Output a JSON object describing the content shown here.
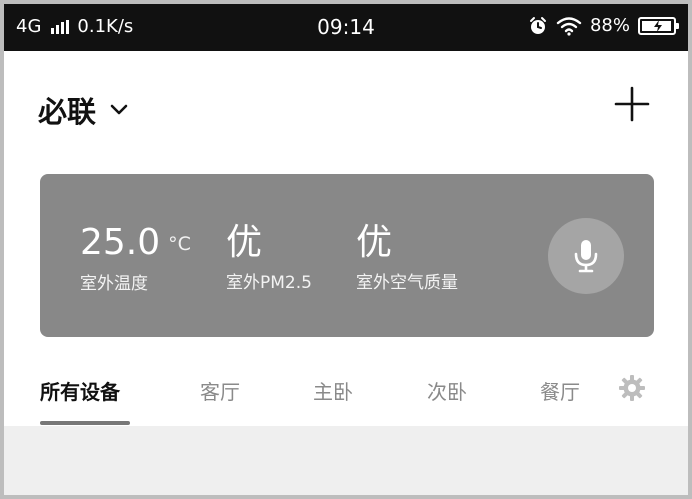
{
  "status_bar": {
    "network": "4G",
    "speed": "0.1K/s",
    "time": "09:14",
    "battery": "88%"
  },
  "header": {
    "title": "必联"
  },
  "weather": {
    "temperature": {
      "value": "25.0",
      "unit": "°C",
      "label": "室外温度"
    },
    "pm25": {
      "value": "优",
      "label": "室外PM2.5"
    },
    "air_quality": {
      "value": "优",
      "label": "室外空气质量"
    }
  },
  "tabs": [
    {
      "label": "所有设备",
      "active": true
    },
    {
      "label": "客厅",
      "active": false
    },
    {
      "label": "主卧",
      "active": false
    },
    {
      "label": "次卧",
      "active": false
    },
    {
      "label": "餐厅",
      "active": false
    }
  ],
  "colors": {
    "status_bar_bg": "#111111",
    "card_bg": "#888888",
    "mic_bg": "#a5a5a5",
    "active_underline": "#777777"
  },
  "icons": {
    "signal": "signal-bars-icon",
    "alarm": "alarm-clock-icon",
    "wifi": "wifi-icon",
    "battery": "battery-charging-icon",
    "dropdown": "chevron-down-icon",
    "add": "plus-icon",
    "mic": "microphone-icon",
    "settings": "gear-icon"
  }
}
